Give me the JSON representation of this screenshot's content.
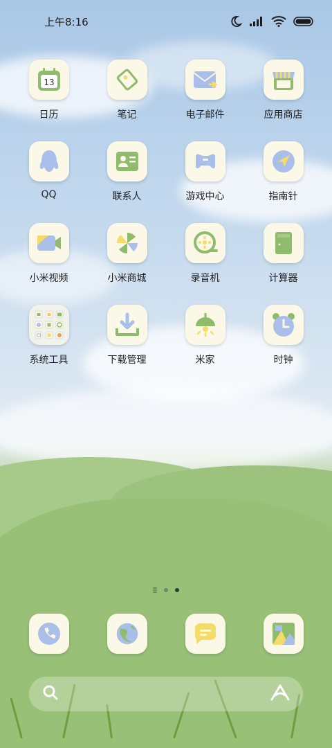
{
  "status": {
    "time": "上午8:16",
    "icons": [
      "moon-icon",
      "signal-icon",
      "wifi-icon",
      "battery-icon"
    ]
  },
  "apps": [
    {
      "label": "日历",
      "icon": "calendar-icon",
      "date": "13"
    },
    {
      "label": "笔记",
      "icon": "notes-icon"
    },
    {
      "label": "电子邮件",
      "icon": "mail-icon"
    },
    {
      "label": "应用商店",
      "icon": "app-store-icon"
    },
    {
      "label": "QQ",
      "icon": "qq-icon"
    },
    {
      "label": "联系人",
      "icon": "contacts-icon"
    },
    {
      "label": "游戏中心",
      "icon": "game-center-icon"
    },
    {
      "label": "指南针",
      "icon": "compass-icon"
    },
    {
      "label": "小米视频",
      "icon": "video-icon"
    },
    {
      "label": "小米商城",
      "icon": "mi-store-icon"
    },
    {
      "label": "录音机",
      "icon": "recorder-icon"
    },
    {
      "label": "计算器",
      "icon": "calculator-icon"
    },
    {
      "label": "系统工具",
      "icon": "folder-icon"
    },
    {
      "label": "下载管理",
      "icon": "download-icon"
    },
    {
      "label": "米家",
      "icon": "mijia-lamp-icon"
    },
    {
      "label": "时钟",
      "icon": "clock-icon"
    }
  ],
  "dock": [
    {
      "icon": "phone-icon"
    },
    {
      "icon": "browser-icon"
    },
    {
      "icon": "messages-icon"
    },
    {
      "icon": "gallery-icon"
    }
  ],
  "search": {
    "icons": [
      "search-icon",
      "assistant-icon"
    ]
  },
  "colors": {
    "icon_bg": "#fbf8e7",
    "green": "#8fbc6c",
    "blue": "#a9bfea",
    "yellow": "#f5dc6a"
  }
}
